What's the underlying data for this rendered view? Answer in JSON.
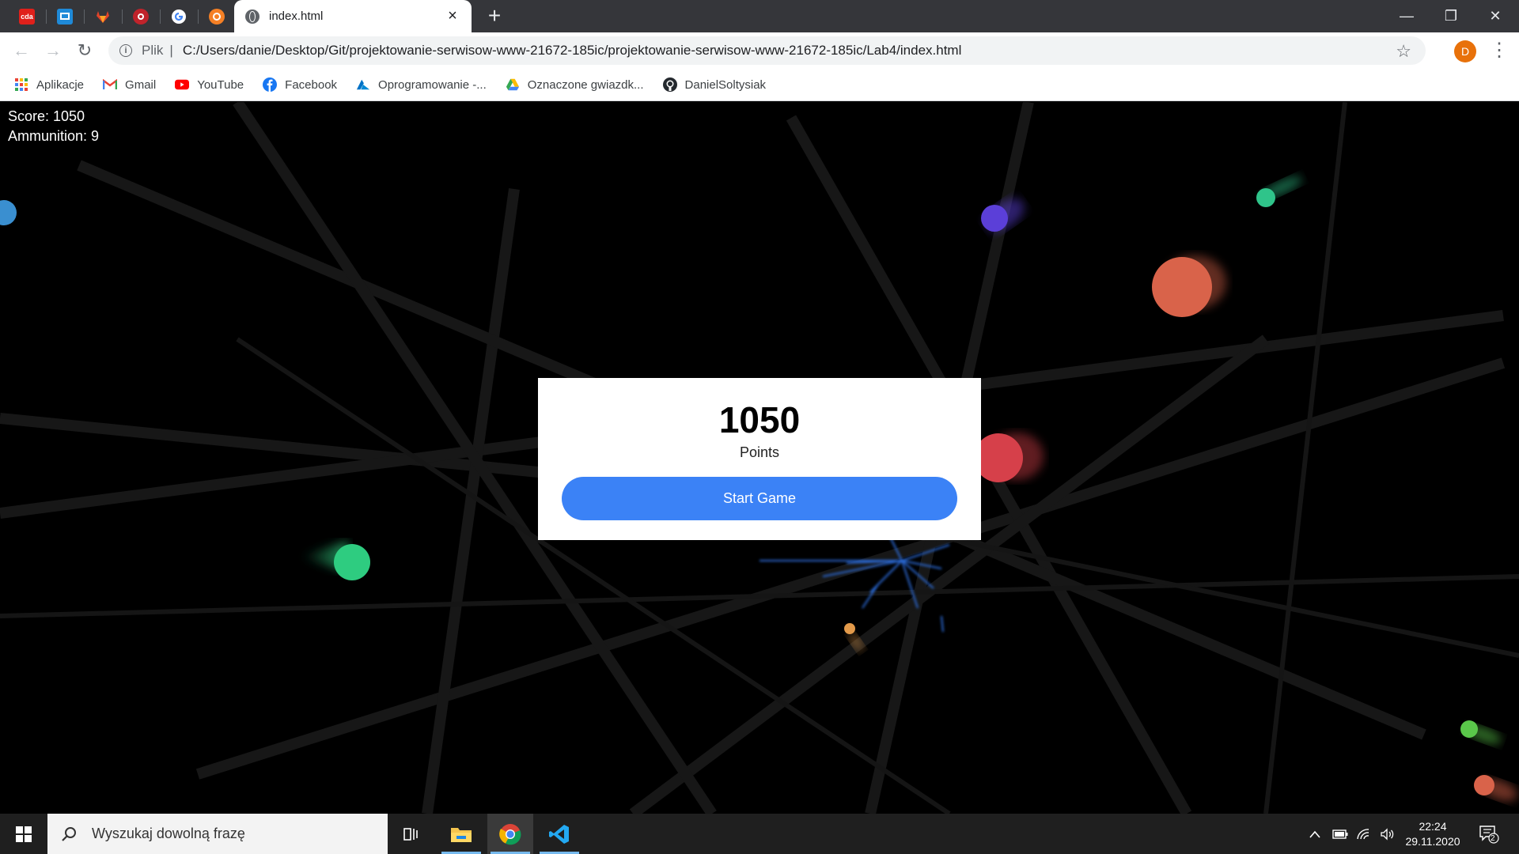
{
  "browser": {
    "pinned_tabs": [
      {
        "icon": "cda-icon",
        "label": "cda",
        "color": "#e0201b"
      },
      {
        "icon": "monitor-icon",
        "color": "#1f8ad8"
      },
      {
        "icon": "gitlab-icon",
        "color": "#e24329"
      },
      {
        "icon": "vivaldi-icon",
        "color": "#c0232b"
      },
      {
        "icon": "google-icon",
        "color": "#ffffff"
      },
      {
        "icon": "ubuntu-icon",
        "color": "#f58025"
      }
    ],
    "active_tab": {
      "title": "index.html",
      "close": "×"
    },
    "new_tab": "+",
    "window_controls": {
      "minimize": "—",
      "restore": "❐",
      "close": "✕"
    },
    "nav": {
      "back": "←",
      "forward": "→",
      "reload": "↻"
    },
    "address": {
      "scheme": "Plik",
      "url": "C:/Users/danie/Desktop/Git/projektowanie-serwisow-www-21672-185ic/projektowanie-serwisow-www-21672-185ic/Lab4/index.html"
    },
    "star": "☆",
    "profile_letter": "D",
    "menu": "⋮",
    "bookmarks": [
      {
        "label": "Aplikacje",
        "icon": "apps-icon"
      },
      {
        "label": "Gmail",
        "icon": "gmail-icon"
      },
      {
        "label": "YouTube",
        "icon": "youtube-icon"
      },
      {
        "label": "Facebook",
        "icon": "facebook-icon"
      },
      {
        "label": "Oprogramowanie -...",
        "icon": "azure-icon"
      },
      {
        "label": "Oznaczone gwiazdk...",
        "icon": "drive-icon"
      },
      {
        "label": "DanielSoltysiak",
        "icon": "github-icon"
      }
    ]
  },
  "game": {
    "score_label": "Score: 1050",
    "ammo_label": "Ammunition: 9",
    "modal": {
      "score": "1050",
      "points_label": "Points",
      "start_button": "Start Game"
    },
    "colors": {
      "button": "#3b82f6",
      "enemy_blue": "#3a8fd0",
      "enemy_purple": "#5b3fd8",
      "enemy_teal": "#2fc48a",
      "enemy_orange": "#d9634a",
      "enemy_red": "#d6404a",
      "enemy_green": "#2ecc80",
      "enemy_lime": "#5ac84a",
      "enemy_amber": "#e39a4a"
    }
  },
  "taskbar": {
    "search_placeholder": "Wyszukaj dowolną frazę",
    "time": "22:24",
    "date": "29.11.2020",
    "notifications": "2",
    "tray_chevron": "^"
  }
}
